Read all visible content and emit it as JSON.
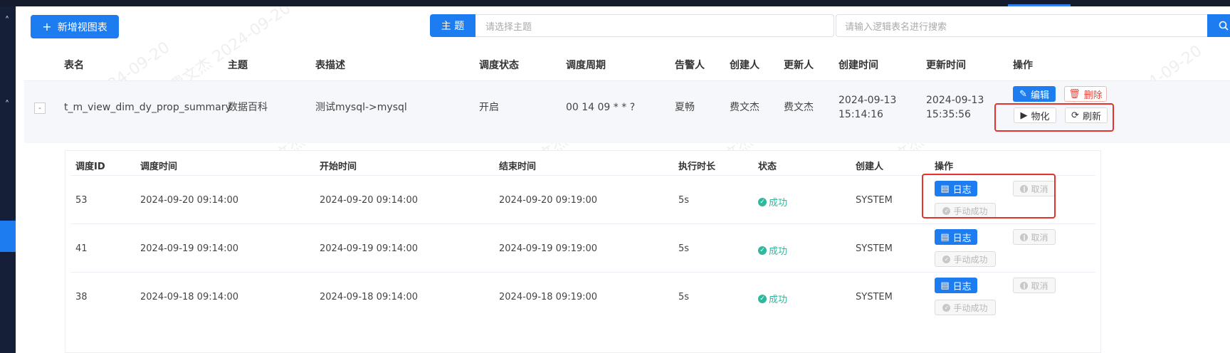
{
  "toolbar": {
    "add_button": "新增视图表",
    "subject_label": "主 题",
    "subject_placeholder": "请选择主题",
    "search_placeholder": "请输入逻辑表名进行搜索"
  },
  "table": {
    "columns": [
      "表名",
      "主题",
      "表描述",
      "调度状态",
      "调度周期",
      "告警人",
      "创建人",
      "更新人",
      "创建时间",
      "更新时间",
      "操作"
    ],
    "row": {
      "expand": "-",
      "name": "t_m_view_dim_dy_prop_summary",
      "subject": "数据百科",
      "description": "测试mysql->mysql",
      "schedule_status": "开启",
      "schedule_cron": "00 14 09 * * ?",
      "alert_user": "夏畅",
      "creator": "费文杰",
      "updater": "费文杰",
      "created_date": "2024-09-13",
      "created_time": "15:14:16",
      "updated_date": "2024-09-13",
      "updated_time": "15:35:56",
      "actions": {
        "edit": "编辑",
        "delete": "删除",
        "materialize": "物化",
        "refresh": "刷新"
      }
    }
  },
  "subtable": {
    "columns": [
      "调度ID",
      "调度时间",
      "开始时间",
      "结束时间",
      "执行时长",
      "状态",
      "创建人",
      "操作"
    ],
    "rows": [
      {
        "id": "53",
        "schedule_time": "2024-09-20 09:14:00",
        "start_time": "2024-09-20 09:14:00",
        "end_time": "2024-09-20 09:19:00",
        "duration": "5s",
        "status": "成功",
        "creator": "SYSTEM"
      },
      {
        "id": "41",
        "schedule_time": "2024-09-19 09:14:00",
        "start_time": "2024-09-19 09:14:00",
        "end_time": "2024-09-19 09:19:00",
        "duration": "5s",
        "status": "成功",
        "creator": "SYSTEM"
      },
      {
        "id": "38",
        "schedule_time": "2024-09-18 09:14:00",
        "start_time": "2024-09-18 09:14:00",
        "end_time": "2024-09-18 09:19:00",
        "duration": "5s",
        "status": "成功",
        "creator": "SYSTEM"
      }
    ],
    "actions": {
      "log": "日志",
      "cancel": "取消",
      "manual_success": "手动成功"
    }
  },
  "watermark": {
    "name": "费文杰",
    "date": "2024-09-20"
  },
  "colors": {
    "primary": "#1d7df0",
    "success": "#2eb89e",
    "danger": "#e5483d",
    "highlight": "#e5322d"
  }
}
